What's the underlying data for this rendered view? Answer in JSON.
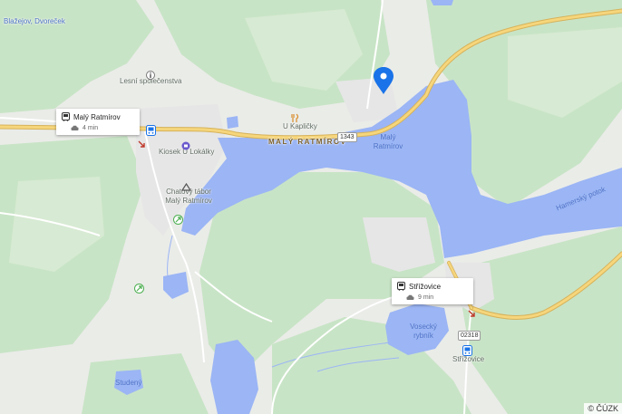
{
  "map": {
    "places": {
      "top_link": "Blažejov, Dvoreček",
      "lesni": "Lesní společenstva",
      "kaplicky": "U Kapličky",
      "town": "MALÝ RATMÍROV",
      "lake": "Malý Ratmírov",
      "kiosek": "Kiosek U Lokálky",
      "tabor": "Chatový tábor Malý Ratmírov",
      "hamersky": "Hamerský potok",
      "vosecky": "Vosecký rybník",
      "strizovice": "Střížovice",
      "studeny": "Studený"
    },
    "roads": {
      "r1343": "1343",
      "r02318": "02318"
    },
    "cards": [
      {
        "title": "Malý Ratmírov",
        "time": "4 min"
      },
      {
        "title": "Střížovice",
        "time": "9 min"
      }
    ],
    "attribution": "© ČÚZK",
    "colors": {
      "water": "#9bb5f5",
      "road": "#f5d27a",
      "park": "#c9e3c7",
      "marker": "#1a73e8"
    }
  }
}
